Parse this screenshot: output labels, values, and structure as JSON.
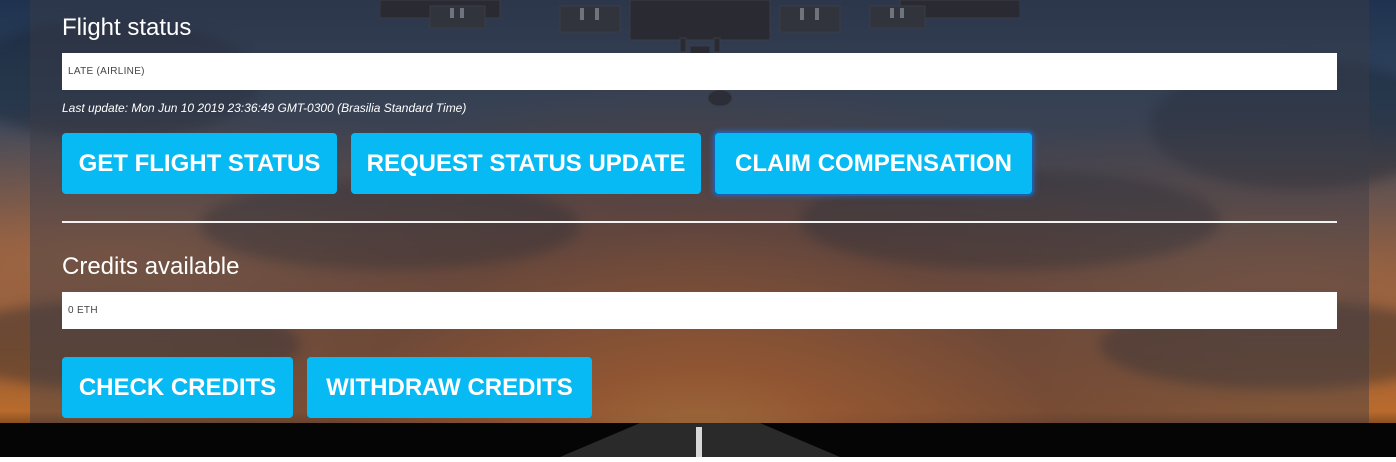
{
  "flight_status": {
    "title": "Flight status",
    "status_value": "LATE (AIRLINE)",
    "last_update": "Last update: Mon Jun 10 2019 23:36:49 GMT-0300 (Brasilia Standard Time)",
    "buttons": {
      "get_status": "GET FLIGHT STATUS",
      "request_update": "REQUEST STATUS UPDATE",
      "claim": "CLAIM COMPENSATION"
    }
  },
  "credits": {
    "title": "Credits available",
    "value": "0 ETH",
    "buttons": {
      "check": "CHECK CREDITS",
      "withdraw": "WITHDRAW CREDITS"
    }
  },
  "colors": {
    "button": "#08baf3",
    "focus_ring": "#1c5fae",
    "text": "#ffffff"
  },
  "background": {
    "scene": "airplane-landing-sunset-runway"
  }
}
